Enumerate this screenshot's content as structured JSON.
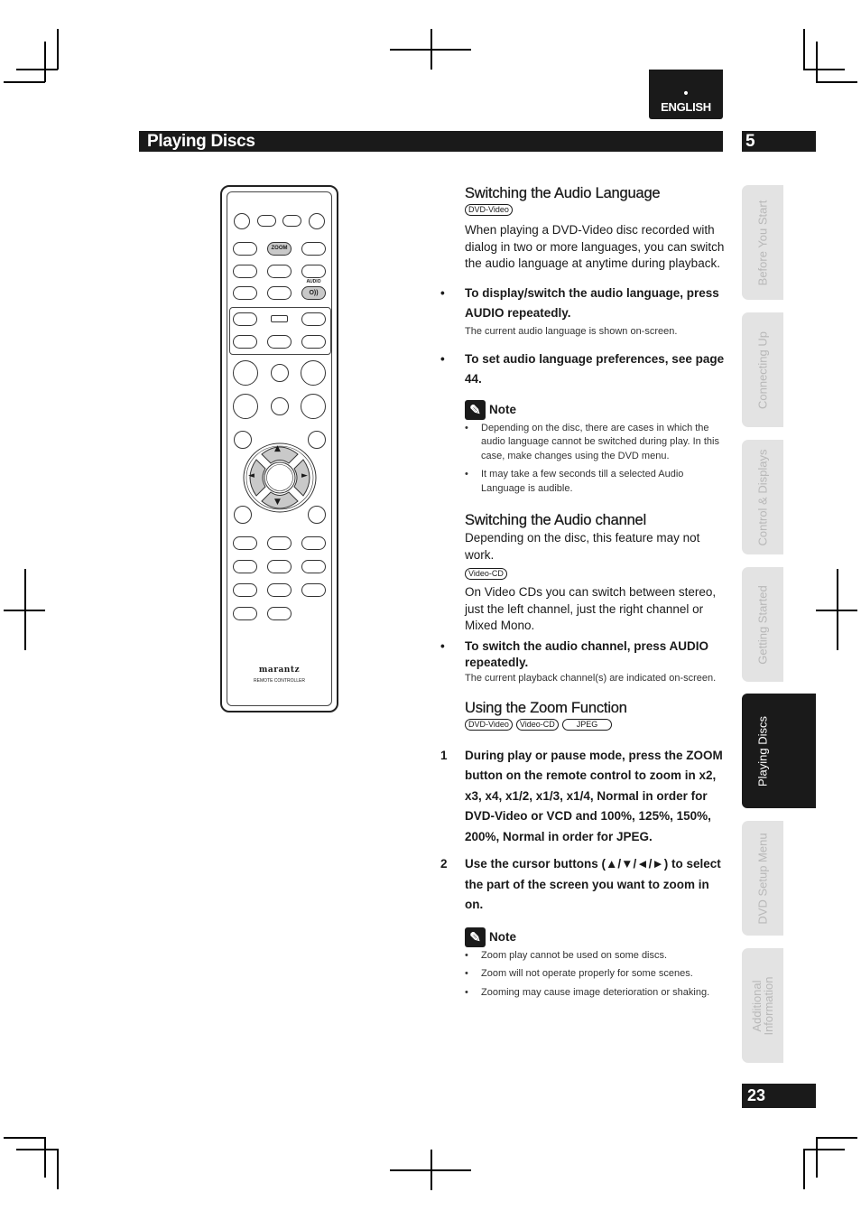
{
  "header": {
    "language_tab": {
      "dot": "•",
      "label": "ENGLISH"
    },
    "section_title": "Playing Discs",
    "chapter_number": "5",
    "page_number": "23"
  },
  "side_tabs": [
    {
      "label": "Before You Start",
      "active": false
    },
    {
      "label": "Connecting Up",
      "active": false
    },
    {
      "label": "Control & Displays",
      "active": false
    },
    {
      "label": "Getting Started",
      "active": false
    },
    {
      "label": "Playing Discs",
      "active": true
    },
    {
      "label": "DVD Setup Menu",
      "active": false
    },
    {
      "label": "Additional Information",
      "active": false
    }
  ],
  "remote": {
    "zoom_button_label": "ZOOM",
    "audio_label": "AUDIO",
    "audio_button_glyph": "O))",
    "cursor_up": "▲",
    "cursor_down": "▼",
    "cursor_left": "◄",
    "cursor_right": "►",
    "brand": "marantz",
    "brand_sub": "REMOTE CONTROLLER"
  },
  "sections": {
    "audio_language": {
      "title": "Switching the Audio Language",
      "badges": [
        "DVD-Video"
      ],
      "intro": "When playing a DVD-Video disc recorded with dialog in two or more languages, you can switch the audio language at anytime during playback.",
      "bullets": [
        {
          "marker": "•",
          "text": "To display/switch the audio language, press AUDIO repeatedly.",
          "sub": "The current audio language is shown on-screen."
        },
        {
          "marker": "•",
          "text": "To set audio language preferences, see page 44.",
          "sub": ""
        }
      ],
      "note": {
        "label": "Note",
        "items": [
          "Depending on the disc, there are cases in which the audio language cannot be switched during play. In this case, make changes using the DVD menu.",
          "It may take a few seconds till a selected Audio Language is audible."
        ]
      }
    },
    "audio_channel": {
      "title": "Switching the Audio channel",
      "intro": "Depending on the disc, this feature may not work.",
      "badges": [
        "Video-CD"
      ],
      "body": "On Video CDs you can switch between stereo, just the left channel, just the right channel or Mixed Mono.",
      "bullets": [
        {
          "marker": "•",
          "text": "To switch the audio channel, press AUDIO repeatedly.",
          "sub": "The current playback channel(s) are indicated on-screen."
        }
      ]
    },
    "zoom_function": {
      "title": "Using the Zoom Function",
      "badges": [
        "DVD-Video",
        "Video-CD",
        "JPEG"
      ],
      "steps": [
        {
          "number": "1",
          "text": "During play or pause mode, press the ZOOM button on the remote control to zoom in x2, x3, x4, x1/2, x1/3, x1/4, Normal in order for DVD-Video or VCD and 100%, 125%, 150%, 200%, Normal in order for JPEG."
        },
        {
          "number": "2",
          "text": "Use the cursor buttons (▲/▼/◄/►) to select the part of the screen you want to zoom in on."
        }
      ],
      "note": {
        "label": "Note",
        "items": [
          "Zoom play cannot be used on some discs.",
          "Zoom will not operate properly for some scenes.",
          "Zooming may cause image deterioration or shaking."
        ]
      }
    }
  },
  "colors": {
    "bar_black": "#1a1a1a",
    "tab_inactive_bg": "#e3e3e3",
    "tab_inactive_text": "#b8b8b8",
    "remote_highlight": "#c9c9c9"
  }
}
